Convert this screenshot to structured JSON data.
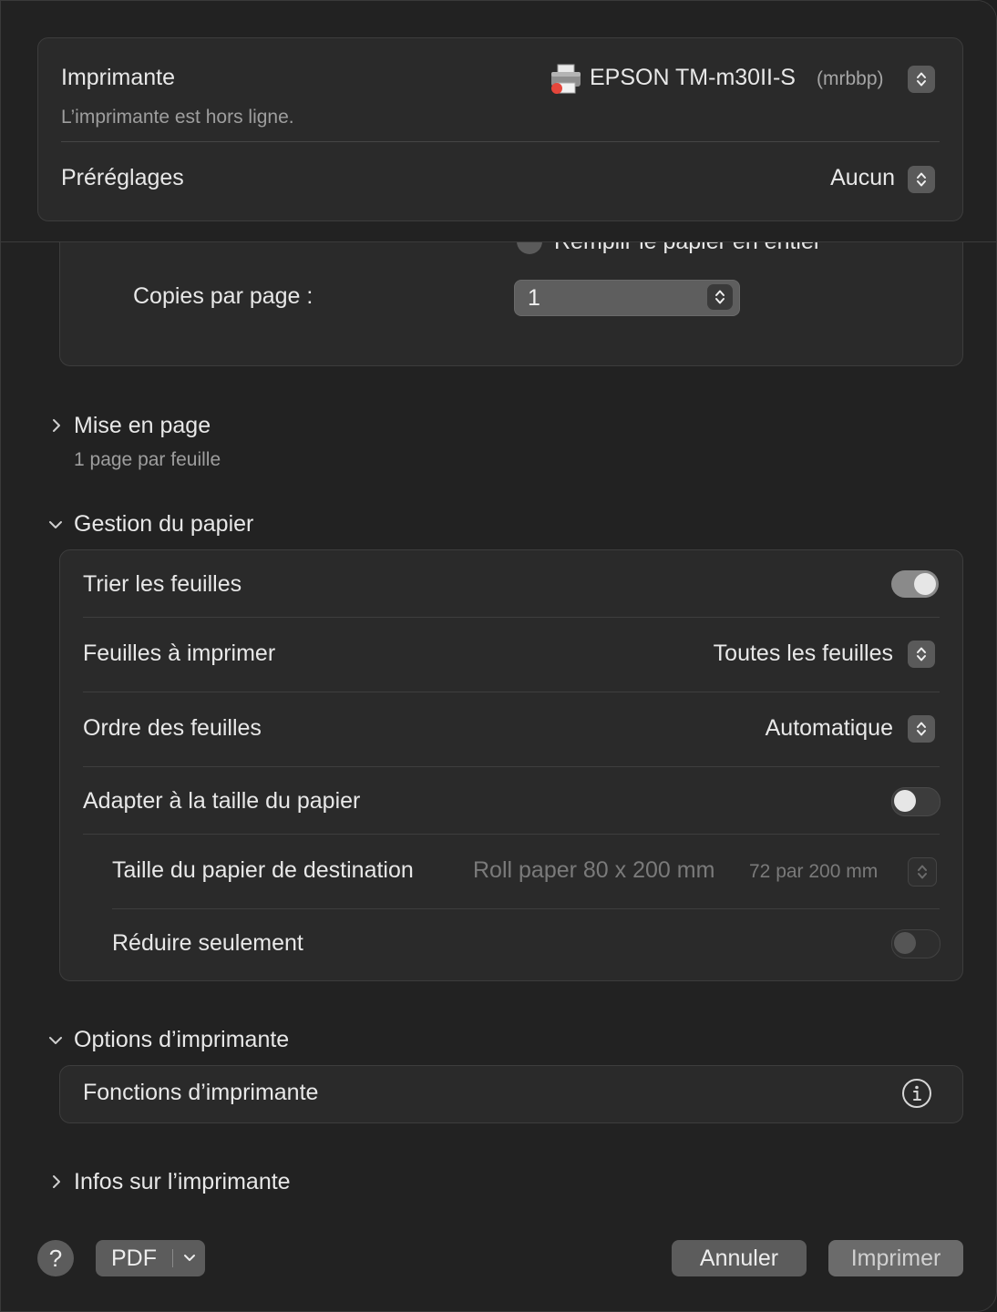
{
  "printer": {
    "label": "Imprimante",
    "status": "L’imprimante est hors ligne.",
    "name": "EPSON TM-m30II-S",
    "host": "(mrbbp)"
  },
  "presets": {
    "label": "Préréglages",
    "value": "Aucun"
  },
  "scroll_partial": {
    "radio_label": "Remplir le papier en entier"
  },
  "copies": {
    "label": "Copies par page :",
    "value": "1"
  },
  "layout": {
    "title": "Mise en page",
    "summary": "1 page par feuille",
    "expanded": false
  },
  "paper_handling": {
    "title": "Gestion du papier",
    "expanded": true,
    "collate": {
      "label": "Trier les feuilles",
      "on": true
    },
    "pages_to_print": {
      "label": "Feuilles à imprimer",
      "value": "Toutes les feuilles"
    },
    "page_order": {
      "label": "Ordre des feuilles",
      "value": "Automatique"
    },
    "scale_to_fit": {
      "label": "Adapter à la taille du papier",
      "on": false
    },
    "dest_paper": {
      "label": "Taille du papier de destination",
      "value": "Roll paper 80 x 200 mm",
      "dims": "72 par 200 mm"
    },
    "scale_down_only": {
      "label": "Réduire seulement",
      "on": false
    }
  },
  "printer_options": {
    "title": "Options d’imprimante",
    "expanded": true,
    "features_label": "Fonctions d’imprimante"
  },
  "printer_info": {
    "title": "Infos sur l’imprimante",
    "expanded": false
  },
  "footer": {
    "help": "?",
    "pdf": "PDF",
    "cancel": "Annuler",
    "print": "Imprimer"
  }
}
